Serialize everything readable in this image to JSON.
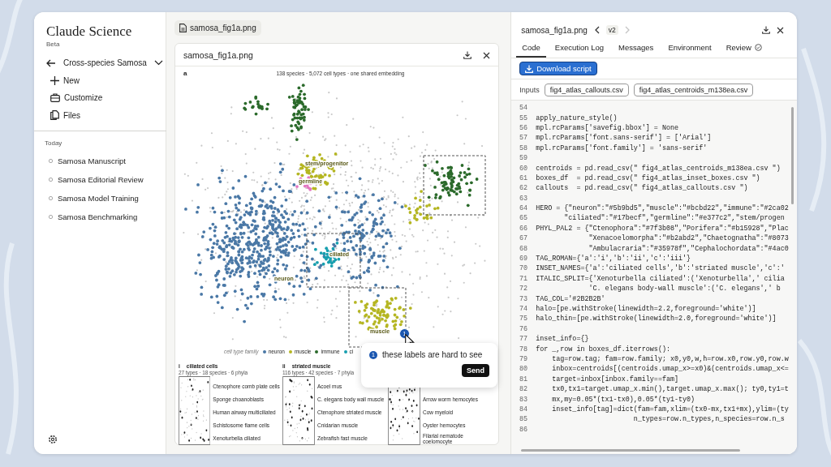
{
  "sidebar": {
    "app_title": "Claude Science",
    "badge": "Beta",
    "project": "Cross-species Samosa",
    "nav": [
      {
        "label": "New",
        "kind": "plus"
      },
      {
        "label": "Customize",
        "kind": "briefcase"
      },
      {
        "label": "Files",
        "kind": "files"
      }
    ],
    "section": "Today",
    "chats": [
      {
        "label": "Samosa Manuscript"
      },
      {
        "label": "Samosa Editorial Review"
      },
      {
        "label": "Samosa Model Training"
      },
      {
        "label": "Samosa Benchmarking"
      }
    ]
  },
  "file_tab": {
    "label": "samosa_fig1a.png"
  },
  "figure_viewer": {
    "title": "samosa_fig1a.png",
    "panel_letter": "a",
    "figure_title": "138 species · 5,072 cell types · one shared embedding",
    "cluster_labels": [
      {
        "text": "stem/progenitor"
      },
      {
        "text": "germline"
      },
      {
        "text": "ciliated"
      },
      {
        "text": "neuron"
      },
      {
        "text": "muscle"
      }
    ],
    "pin_number": "1",
    "legend": {
      "title": "cell type family",
      "items": [
        {
          "label": "neuron",
          "color": "#4a78a6"
        },
        {
          "label": "muscle",
          "color": "#b5b622"
        },
        {
          "label": "immune",
          "color": "#2b6a2b"
        },
        {
          "label": "ci",
          "color": "#179faf"
        }
      ]
    },
    "insets": [
      {
        "tag": "i",
        "name": "ciliated cells",
        "stats": "27 types · 18 species · 6 phyla",
        "labels": [
          "Ctenophore comb plate cells",
          "Sponge choanoblasts",
          "Human airway multiciliated",
          "Schistosome flame cells",
          "Xenoturbella ciliated"
        ]
      },
      {
        "tag": "ii",
        "name": "striated muscle",
        "stats": "116 types · 42 species · 7 phyla",
        "labels": [
          "Acoel mus",
          "C. elegans body wall muscle",
          "Ctenophore striated muscle",
          "Cnidarian muscle",
          "Zebrafish fast muscle"
        ]
      },
      {
        "labels": [
          "Arrow worm hemocytes",
          "Cow myeloid",
          "Oyster hemocytes",
          "Filarial nematode coelomocyte"
        ]
      }
    ],
    "comment": {
      "number": "1",
      "text": "these labels are hard to see",
      "button": "Send"
    }
  },
  "code_panel": {
    "title": "samosa_fig1a.png",
    "version": "v2",
    "prev_disabled": false,
    "next_disabled": true,
    "tabs": [
      {
        "label": "Code",
        "selected": true
      },
      {
        "label": "Execution Log",
        "selected": false
      },
      {
        "label": "Messages",
        "selected": false
      },
      {
        "label": "Environment",
        "selected": false
      },
      {
        "label": "Review",
        "selected": false,
        "kind": "check"
      }
    ],
    "download_button": "Download script",
    "inputs_label": "Inputs",
    "inputs": [
      "fig4_atlas_callouts.csv",
      "fig4_atlas_centroids_m138ea.csv"
    ],
    "lines": [
      {
        "number": "54"
      },
      {
        "number": "55",
        "text": "apply_nature_style()"
      },
      {
        "number": "56",
        "text": "mpl.rcParams['savefig.bbox'] = None"
      },
      {
        "number": "57",
        "text": "mpl.rcParams['font.sans-serif'] = ['Arial']"
      },
      {
        "number": "58",
        "text": "mpl.rcParams['font.family'] = 'sans-serif'"
      },
      {
        "number": "59"
      },
      {
        "number": "60",
        "text": "centroids = pd.read_csv(\" fig4_atlas_centroids_m138ea.csv \")"
      },
      {
        "number": "61",
        "text": "boxes_df  = pd.read_csv(\" fig4_atlas_inset_boxes.csv \")"
      },
      {
        "number": "62",
        "text": "callouts  = pd.read_csv(\" fig4_atlas_callouts.csv \")"
      },
      {
        "number": "63"
      },
      {
        "number": "64",
        "text": "HERO = {\"neuron\":\"#5b9bd5\",\"muscle\":\"#bcbd22\",\"immune\":\"#2ca02"
      },
      {
        "number": "65",
        "text": "       \"ciliated\":\"#17becf\",\"germline\":\"#e377c2\",\"stem/progen"
      },
      {
        "number": "66",
        "text": "PHYL_PAL2 = {\"Ctenophora\":\"#7f3b08\",\"Porifera\":\"#b15928\",\"Plac"
      },
      {
        "number": "67",
        "text": "             \"Xenacoelomorpha\":\"#b2abd2\",\"Chaetognatha\":\"#8073"
      },
      {
        "number": "68",
        "text": "             \"Ambulacraria\":\"#35978f\",\"Cephalochordata\":\"#4ac0"
      },
      {
        "number": "69",
        "text": "TAG_ROMAN={'a':'i','b':'ii','c':'iii'}"
      },
      {
        "number": "70",
        "text": "INSET_NAMES={'a':'ciliated cells','b':'striated muscle','c':'"
      },
      {
        "number": "71",
        "text": "ITALIC_SPLIT={'Xenoturbella ciliated':('Xenoturbella',' cilia"
      },
      {
        "number": "72",
        "text": "             'C. elegans body-wall muscle':('C. elegans',' b"
      },
      {
        "number": "73",
        "text": "TAG_COL='#2B2B2B'"
      },
      {
        "number": "74",
        "text": "halo=[pe.withStroke(linewidth=2.2,foreground='white')]"
      },
      {
        "number": "75",
        "text": "halo_thin=[pe.withStroke(linewidth=2.0,foreground='white')]"
      },
      {
        "number": "76"
      },
      {
        "number": "77",
        "text": "inset_info={}"
      },
      {
        "number": "78",
        "text": "for _,row in boxes_df.iterrows():"
      },
      {
        "number": "79",
        "text": "    tag=row.tag; fam=row.family; x0,y0,w,h=row.x0,row.y0,row.w"
      },
      {
        "number": "80",
        "text": "    inbox=centroids[(centroids.umap_x>=x0)&(centroids.umap_x<="
      },
      {
        "number": "81",
        "text": "    target=inbox[inbox.family==fam]"
      },
      {
        "number": "82",
        "text": "    tx0,tx1=target.umap_x.min(),target.umap_x.max(); ty0,ty1=t"
      },
      {
        "number": "83",
        "text": "    mx,my=0.05*(tx1-tx0),0.05*(ty1-ty0)"
      },
      {
        "number": "84",
        "text": "    inset_info[tag]=dict(fam=fam,xlim=(tx0-mx,tx1+mx),ylim=(ty"
      },
      {
        "number": "85",
        "text": "                        n_types=row.n_types,n_species=row.n_s"
      },
      {
        "number": "86"
      }
    ]
  }
}
